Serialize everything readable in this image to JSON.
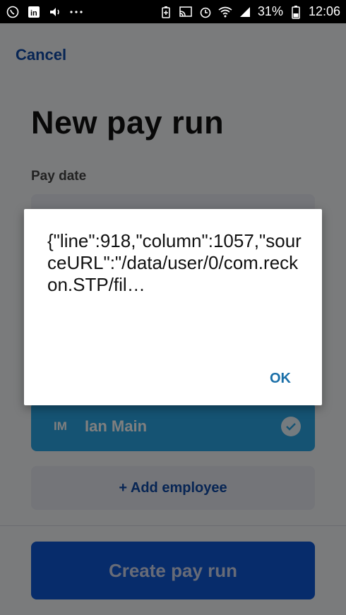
{
  "status_bar": {
    "battery": "31%",
    "time": "12:06",
    "icons_left": [
      "whatsapp-icon",
      "linkedin-icon",
      "volume-icon",
      "more-icon"
    ],
    "icons_right": [
      "battery-saver-icon",
      "cast-icon",
      "alarm-icon",
      "wifi-icon",
      "signal-icon",
      "battery-icon"
    ]
  },
  "header": {
    "cancel_label": "Cancel",
    "title": "New pay run"
  },
  "form": {
    "pay_date_label": "Pay date"
  },
  "employees": [
    {
      "initials": "IM",
      "name": "Ian Main",
      "selected": true
    }
  ],
  "actions": {
    "add_employee_label": "+ Add employee",
    "create_label": "Create pay run"
  },
  "dialog": {
    "message": "{\"line\":918,\"column\":1057,\"sourceURL\":\"/data/user/0/com.reckon.STP/fil…",
    "ok_label": "OK"
  },
  "colors": {
    "primary": "#0e58d6",
    "employee_card": "#2aa6e6",
    "link": "#0f4aa8",
    "dialog_ok": "#1a6fa8"
  }
}
